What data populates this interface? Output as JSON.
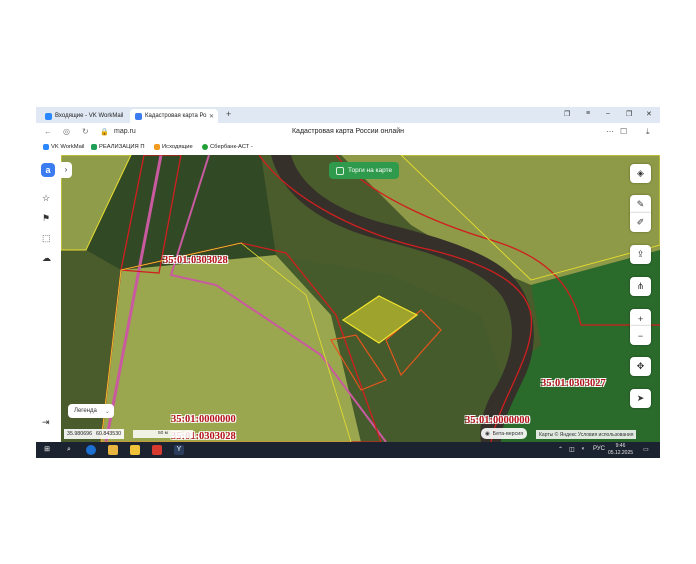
{
  "browser": {
    "tabs": [
      {
        "label": "Входящие - VK WorkMail",
        "active": false
      },
      {
        "label": "Кадастровая карта Ро",
        "active": true
      }
    ],
    "url": "map.ru",
    "page_title": "Кадастровая карта России онлайн",
    "bookmarks": [
      {
        "label": "VK WorkMail"
      },
      {
        "label": "РЕАЛИЗАЦИЯ П"
      },
      {
        "label": "Исходящие"
      },
      {
        "label": "Сбербанк-АСТ - "
      }
    ]
  },
  "map": {
    "trade_button": "Торги на карте",
    "legend_button": "Легенда",
    "cadastral_labels": [
      "35:01:0303028",
      "35:01:0303027",
      "35:01:0000000",
      "35:01:0000000",
      "35:01:0303028"
    ],
    "coords": {
      "lat": "35.980696",
      "lon": "60.843530"
    },
    "scale_label": "50 м",
    "beta_label": "Бета-версия",
    "attribution": "Карты © Яндекс  Условия использования"
  },
  "taskbar": {
    "language": "РУС",
    "time": "9:46",
    "date": "05.12.2025"
  },
  "colors": {
    "parcel_red": "#d01f1f",
    "parcel_yellow": "#e8de2f",
    "river": "#3a2f22",
    "accent_green": "#2f9a4c"
  }
}
